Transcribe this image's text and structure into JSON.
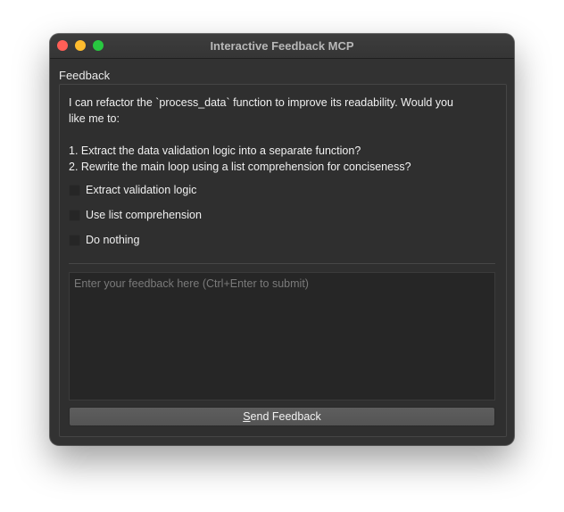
{
  "window": {
    "title": "Interactive Feedback MCP"
  },
  "feedback_group": {
    "label": "Feedback",
    "message_lines": [
      "I can refactor the `process_data` function to improve its readability. Would you",
      "like me to:",
      "1. Extract the data validation logic into a separate function?",
      "2. Rewrite the main loop using a list comprehension for conciseness?"
    ],
    "options": [
      {
        "label": "Extract validation logic",
        "checked": false
      },
      {
        "label": "Use list comprehension",
        "checked": false
      },
      {
        "label": "Do nothing",
        "checked": false
      }
    ]
  },
  "feedback_input": {
    "placeholder": "Enter your feedback here (Ctrl+Enter to submit)",
    "value": ""
  },
  "send_button": {
    "mnemonic": "S",
    "label_rest": "end Feedback"
  },
  "colors": {
    "close": "#ff5f57",
    "minimize": "#febc2e",
    "maximize": "#28c840",
    "window_bg": "#323232"
  }
}
